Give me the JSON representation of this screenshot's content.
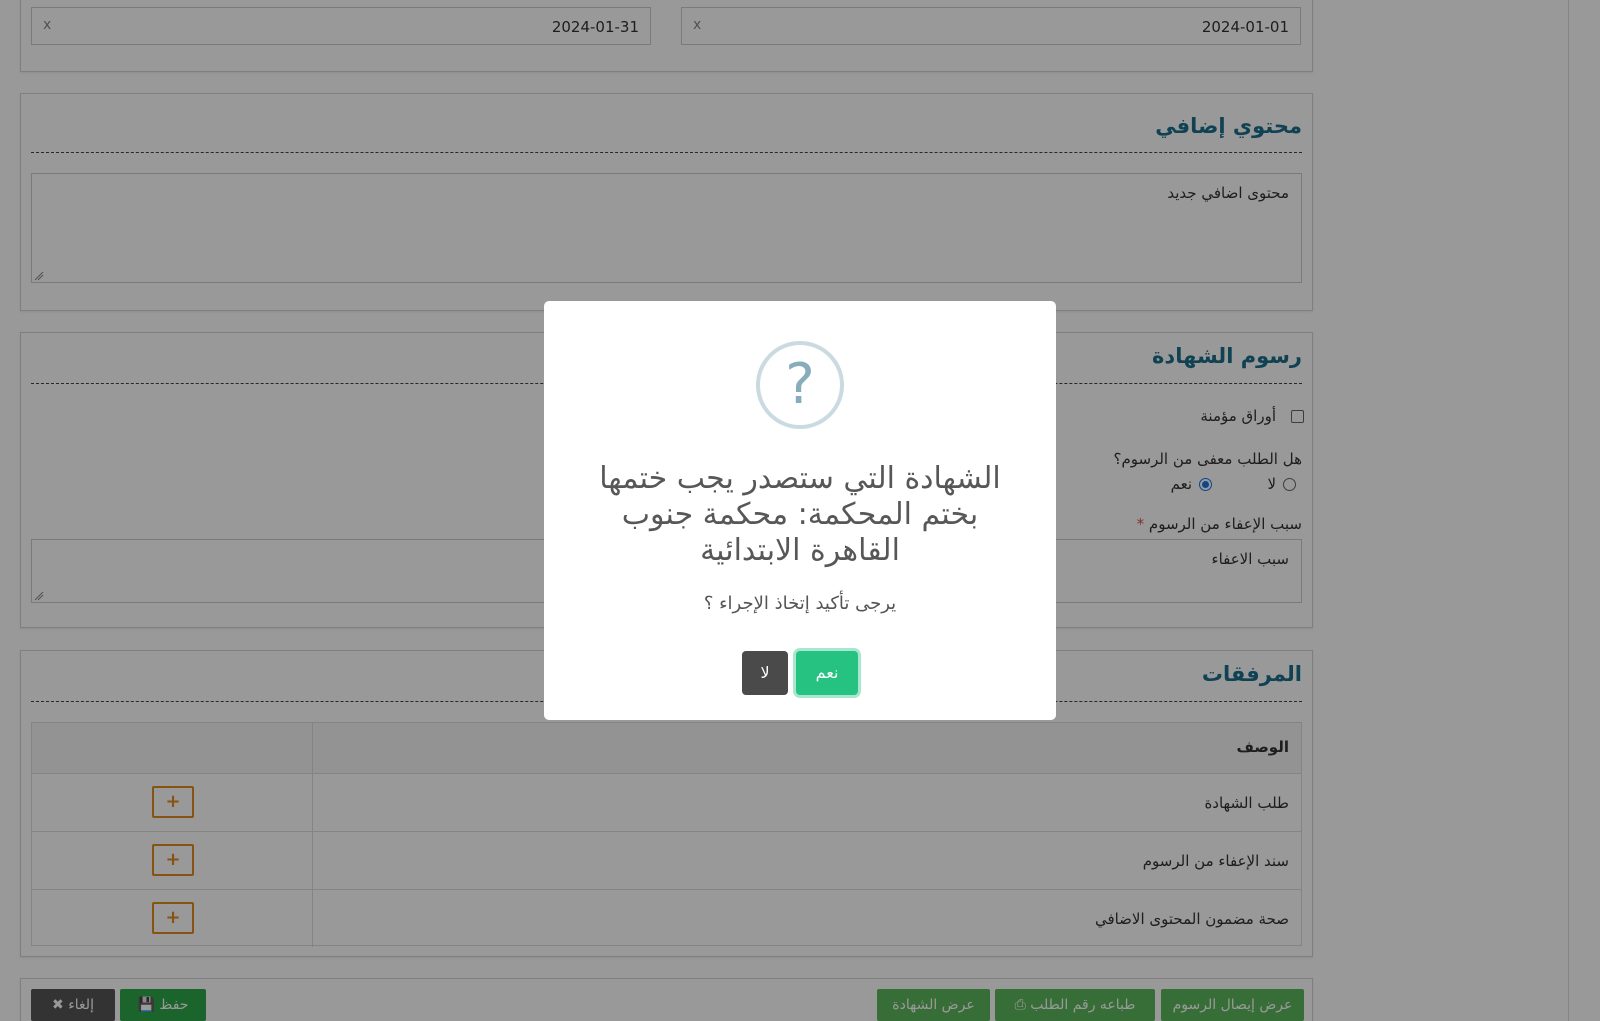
{
  "period": {
    "from_date": "2024-01-01",
    "to_date": "2024-01-31",
    "clear_symbol": "x"
  },
  "extra_content": {
    "title": "محتوي إضافي",
    "value": "محتوى اضافي جديد"
  },
  "fees": {
    "title": "رسوم الشهادة",
    "secure_papers_label": "أوراق مؤمنة",
    "secure_papers_checked": false,
    "exempt_question": "هل الطلب معفى من الرسوم؟",
    "option_yes": "نعم",
    "option_no": "لا",
    "selected_option": "نعم",
    "exempt_reason_label": "سبب الإعفاء من الرسوم",
    "required_mark": "*",
    "exempt_reason_value": "سبب الاعفاء"
  },
  "attachments": {
    "title": "المرفقات",
    "column_description": "الوصف",
    "add_symbol": "+",
    "rows": [
      {
        "description": "طلب الشهادة"
      },
      {
        "description": "سند الإعفاء من الرسوم"
      },
      {
        "description": "صحة مضمون المحتوى الاضافي"
      }
    ]
  },
  "actions": {
    "show_fee_receipt": "عرض إيصال الرسوم",
    "print_request_number": "طباعه رقم الطلب",
    "show_certificate": "عرض الشهادة",
    "save": "حفظ",
    "cancel": "إلغاء"
  },
  "dialog": {
    "icon": "question-icon",
    "title": "الشهادة التي ستصدر يجب ختمها بختم المحكمة: محكمة جنوب القاهرة الابتدائية",
    "text": "يرجى تأكيد إتخاذ الإجراء ؟",
    "confirm": "نعم",
    "cancel": "لا"
  },
  "colors": {
    "section_title": "#1b6f8a",
    "green_button": "#5cb85c",
    "confirm_button": "#26c281",
    "add_button_border": "#e08a1e"
  }
}
